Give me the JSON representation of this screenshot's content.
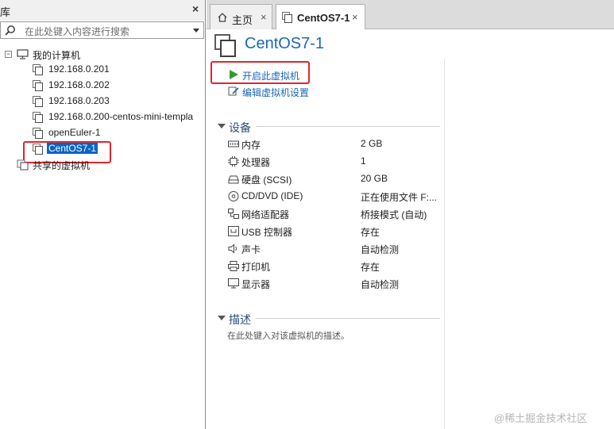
{
  "library": {
    "title": "库",
    "search_placeholder": "在此处键入内容进行搜索",
    "tree": {
      "root_label": "我的计算机",
      "expand_symbol": "⊟",
      "items": [
        "192.168.0.201",
        "192.168.0.202",
        "192.168.0.203",
        "192.168.0.200-centos-mini-templa",
        "openEuler-1",
        "CentOS7-1"
      ],
      "shared_label": "共享的虚拟机"
    }
  },
  "tabs": [
    {
      "label": "主页",
      "icon": "home-icon",
      "close": "×"
    },
    {
      "label": "CentOS7-1",
      "icon": "vm-icon",
      "close": "×"
    }
  ],
  "vm": {
    "name": "CentOS7-1",
    "actions": {
      "power_on": "开启此虚拟机",
      "edit_settings": "编辑虚拟机设置"
    }
  },
  "devices": {
    "section_title": "设备",
    "items": [
      {
        "name": "内存",
        "value": "2 GB",
        "icon": "memory-icon"
      },
      {
        "name": "处理器",
        "value": "1",
        "icon": "cpu-icon"
      },
      {
        "name": "硬盘 (SCSI)",
        "value": "20 GB",
        "icon": "hdd-icon"
      },
      {
        "name": "CD/DVD (IDE)",
        "value": "正在使用文件 F:...",
        "icon": "cd-icon"
      },
      {
        "name": "网络适配器",
        "value": "桥接模式 (自动)",
        "icon": "network-icon"
      },
      {
        "name": "USB 控制器",
        "value": "存在",
        "icon": "usb-icon"
      },
      {
        "name": "声卡",
        "value": "自动检测",
        "icon": "sound-icon"
      },
      {
        "name": "打印机",
        "value": "存在",
        "icon": "printer-icon"
      },
      {
        "name": "显示器",
        "value": "自动检测",
        "icon": "display-icon"
      }
    ]
  },
  "description": {
    "section_title": "描述",
    "placeholder": "在此处键入对该虚拟机的描述。"
  },
  "watermark": "@稀土掘金技术社区",
  "colors": {
    "accent_blue": "#1b66b8",
    "selection_blue": "#0a64c8",
    "highlight_red": "#e0262c",
    "play_green": "#2f9e2f"
  }
}
